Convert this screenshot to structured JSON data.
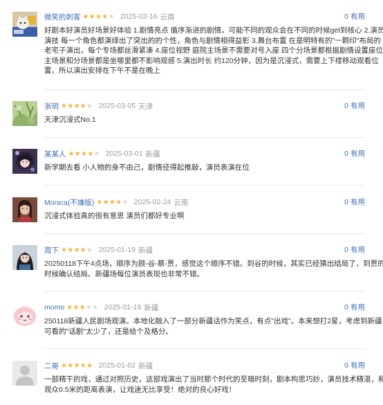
{
  "reviews": [
    {
      "user": "微笑的刺客",
      "rating": 4,
      "date": "2025-03-16",
      "location": "云南",
      "useful_count": "0",
      "useful_label": "有用",
      "avatar": "cat-photo-icon",
      "lines": [
        "好剧本好演员好场景好体验 1.剧情亮点 循序渐进的剧情，可能不同的观众会在不同的时候get到核心 2.演员",
        "演技 每一个角色都演绎出了突出的的个性，角色与剧情相得益彰 3.舞台布置 在是明特有的\"一颗印\"布局的",
        "老宅子演出，每个专场都丝滑紧凑 4.座位视野 庭院主场景不需要对号入座 四个分场景都根据剧情设置座位;",
        "主场景和分场景都是坐哪里都不影响观感 5.演出时长 约120分钟，因为是沉浸式，需要上下楼移动观看位",
        "置，所以演出安排在下午不是在晚上"
      ]
    },
    {
      "user": "浙玥",
      "rating": 4,
      "date": "2025-03-05",
      "location": "天津",
      "useful_count": "0",
      "useful_label": "有用",
      "avatar": "green-plant-photo-icon",
      "lines": [
        "天津沉浸式No.1"
      ]
    },
    {
      "user": "某某人",
      "rating": 4,
      "date": "2025-03-01",
      "location": "新疆",
      "useful_count": "0",
      "useful_label": "有用",
      "avatar": "illustrated-girl-avatar-icon",
      "lines": [
        "新学期去看 小人物的身不由己，剧情径得起推敲，演员表演在位"
      ]
    },
    {
      "user": "Monica(不嫌版)",
      "rating": 4,
      "date": "2025-02-24",
      "location": "云南",
      "useful_count": "0",
      "useful_label": "有用",
      "avatar": "woman-portrait-avatar-icon",
      "lines": [
        "沉浸式体验真的很有意思 演员们都好专业啊"
      ]
    },
    {
      "user": "周下",
      "rating": 4,
      "date": "2025-01-19",
      "location": "新疆",
      "useful_count": "0",
      "useful_label": "有用",
      "avatar": "woman-portrait-avatar-icon",
      "lines": [
        "20250118下午4点场，顺序为顾-谷-蔡-贾，感觉这个顺序不错。到谷的时候，其实已经猜出结局了，到贾的",
        "时候确认结局。新疆场每位演员表现也非常不错。"
      ]
    },
    {
      "user": "momo",
      "rating": 3,
      "date": "2025-01-19",
      "location": "新疆",
      "useful_count": "0",
      "useful_label": "有用",
      "avatar": "pink-cartoon-avatar-icon",
      "lines": [
        "250118新疆人民剧场观演。本地化融入了一部分新疆话作为笑点，有点\"出戏\"。本来想打2星，考虑到新疆",
        "可看的\"话剧\"太少了，还是给个及格分。"
      ]
    },
    {
      "user": "二哥",
      "rating": 5,
      "date": "2025-01-02",
      "location": "新疆",
      "useful_count": "0",
      "useful_label": "有用",
      "avatar": "default-user-avatar-icon",
      "lines": [
        "一部精干的戏，通过对照历史，这部戏演出了当时那个时代的至暗时刻，剧本构思巧妙，演员技术精湛，和",
        "观众0.5米的距离表演，让戏迷无比享受！绝对的良心好戏！"
      ]
    }
  ]
}
